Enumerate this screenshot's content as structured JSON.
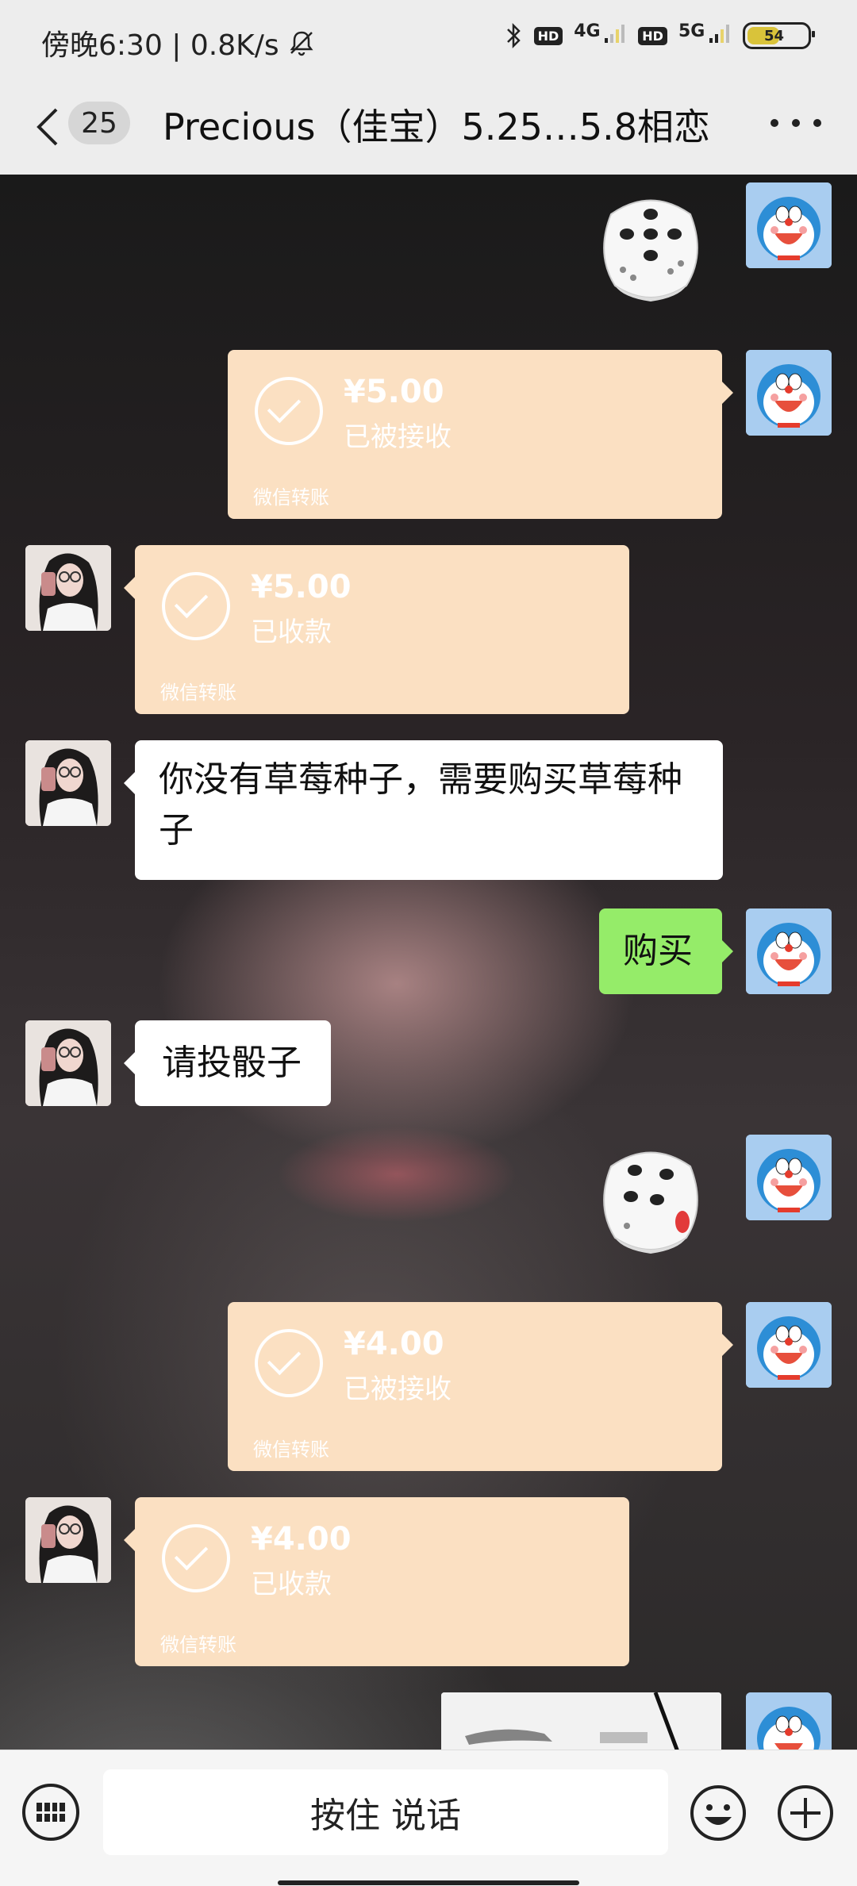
{
  "status_bar": {
    "time_speed": "傍晚6:30 | 0.8K/s",
    "hd1": "HD",
    "net1": "4G",
    "hd2": "HD",
    "net2": "5G",
    "battery": "54"
  },
  "header": {
    "unread_count": "25",
    "title": "Precious（佳宝）5.25…5.8相恋"
  },
  "messages": [
    {
      "type": "dice",
      "side": "right",
      "value": 5
    },
    {
      "type": "transfer",
      "side": "right",
      "amount": "¥5.00",
      "status": "已被接收",
      "source": "微信转账"
    },
    {
      "type": "transfer",
      "side": "left",
      "amount": "¥5.00",
      "status": "已收款",
      "source": "微信转账"
    },
    {
      "type": "text",
      "side": "left",
      "text": "你没有草莓种子，需要购买草莓种子"
    },
    {
      "type": "text",
      "side": "right",
      "text": "购买"
    },
    {
      "type": "text",
      "side": "left",
      "text": "请投骰子"
    },
    {
      "type": "dice",
      "side": "right",
      "value": 4
    },
    {
      "type": "transfer",
      "side": "right",
      "amount": "¥4.00",
      "status": "已被接收",
      "source": "微信转账"
    },
    {
      "type": "transfer",
      "side": "left",
      "amount": "¥4.00",
      "status": "已收款",
      "source": "微信转账"
    },
    {
      "type": "image",
      "side": "right"
    }
  ],
  "input_bar": {
    "voice_label": "按住 说话"
  },
  "colors": {
    "transfer_bg": "#fbe0c2",
    "sent_bubble": "#95ec69",
    "received_bubble": "#ffffff"
  }
}
